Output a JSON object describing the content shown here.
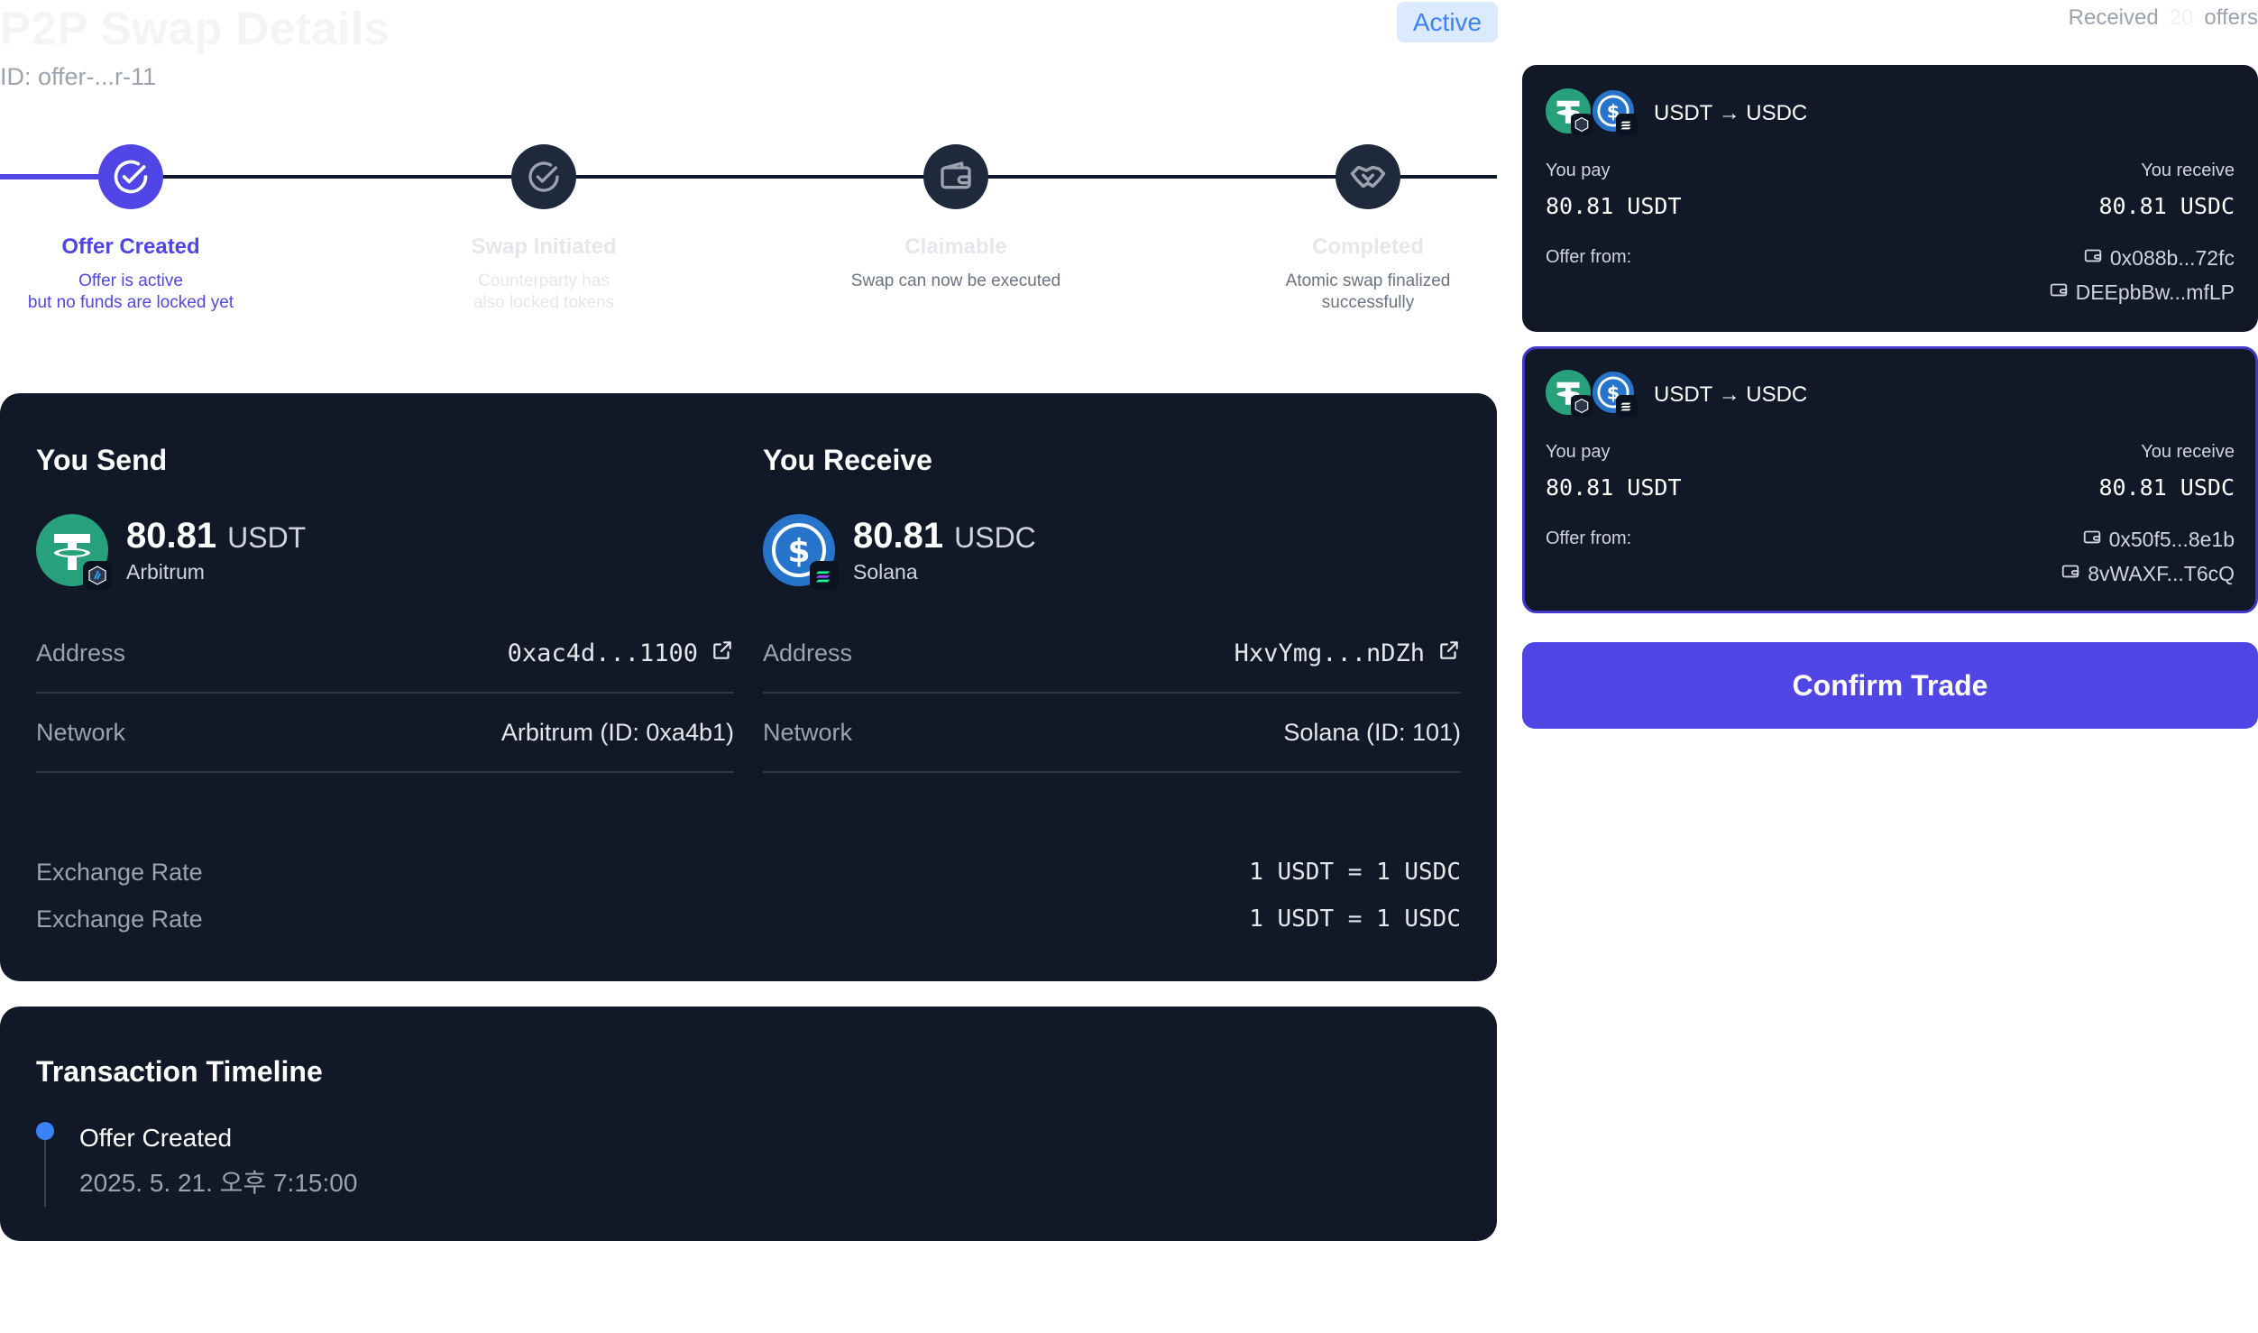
{
  "header": {
    "title": "P2P Swap Details",
    "offer_id": "ID: offer-...r-11",
    "status": "Active",
    "received_prefix": "Received",
    "received_count": "20",
    "received_suffix": "offers"
  },
  "stepper": {
    "steps": [
      {
        "title": "Offer Created",
        "desc_1": "Offer is active",
        "desc_2": "but no funds are locked yet",
        "state": "active"
      },
      {
        "title": "Swap Initiated",
        "desc_1": "Counterparty has",
        "desc_2": "also locked tokens",
        "state": "pending"
      },
      {
        "title": "Claimable",
        "desc_1": "Swap can now be executed",
        "desc_2": "",
        "state": "pending"
      },
      {
        "title": "Completed",
        "desc_1": "Atomic swap finalized",
        "desc_2": "successfully",
        "state": "pending"
      }
    ]
  },
  "details": {
    "send": {
      "heading": "You Send",
      "amount": "80.81",
      "symbol": "USDT",
      "chain": "Arbitrum",
      "address_label": "Address",
      "address": "0xac4d...1100",
      "network_label": "Network",
      "network": "Arbitrum (ID: 0xa4b1)"
    },
    "receive": {
      "heading": "You Receive",
      "amount": "80.81",
      "symbol": "USDC",
      "chain": "Solana",
      "address_label": "Address",
      "address": "HxvYmg...nDZh",
      "network_label": "Network",
      "network": "Solana (ID: 101)"
    },
    "rates": [
      {
        "label": "Exchange Rate",
        "value": "1 USDT = 1 USDC"
      },
      {
        "label": "Exchange Rate",
        "value": "1 USDT = 1 USDC"
      }
    ]
  },
  "timeline": {
    "title": "Transaction Timeline",
    "events": [
      {
        "label": "Offer Created",
        "time": "2025. 5. 21. 오후 7:15:00"
      }
    ]
  },
  "offers": [
    {
      "pair": "USDT → USDC",
      "pay_label": "You pay",
      "pay": "80.81 USDT",
      "receive_label": "You receive",
      "receive": "80.81 USDC",
      "from_label": "Offer from:",
      "address_1": "0x088b...72fc",
      "address_2": "DEEpbBw...mfLP"
    },
    {
      "pair": "USDT → USDC",
      "pay_label": "You pay",
      "pay": "80.81 USDT",
      "receive_label": "You receive",
      "receive": "80.81 USDC",
      "from_label": "Offer from:",
      "address_1": "0x50f5...8e1b",
      "address_2": "8vWAXF...T6cQ"
    }
  ],
  "confirm_label": "Confirm Trade",
  "colors": {
    "accent": "#4f46e5",
    "card_bg": "#111827",
    "usdt": "#26a17b",
    "usdc": "#2775ca",
    "status_bg": "#dbeafe",
    "status_text": "#3b82f6"
  }
}
